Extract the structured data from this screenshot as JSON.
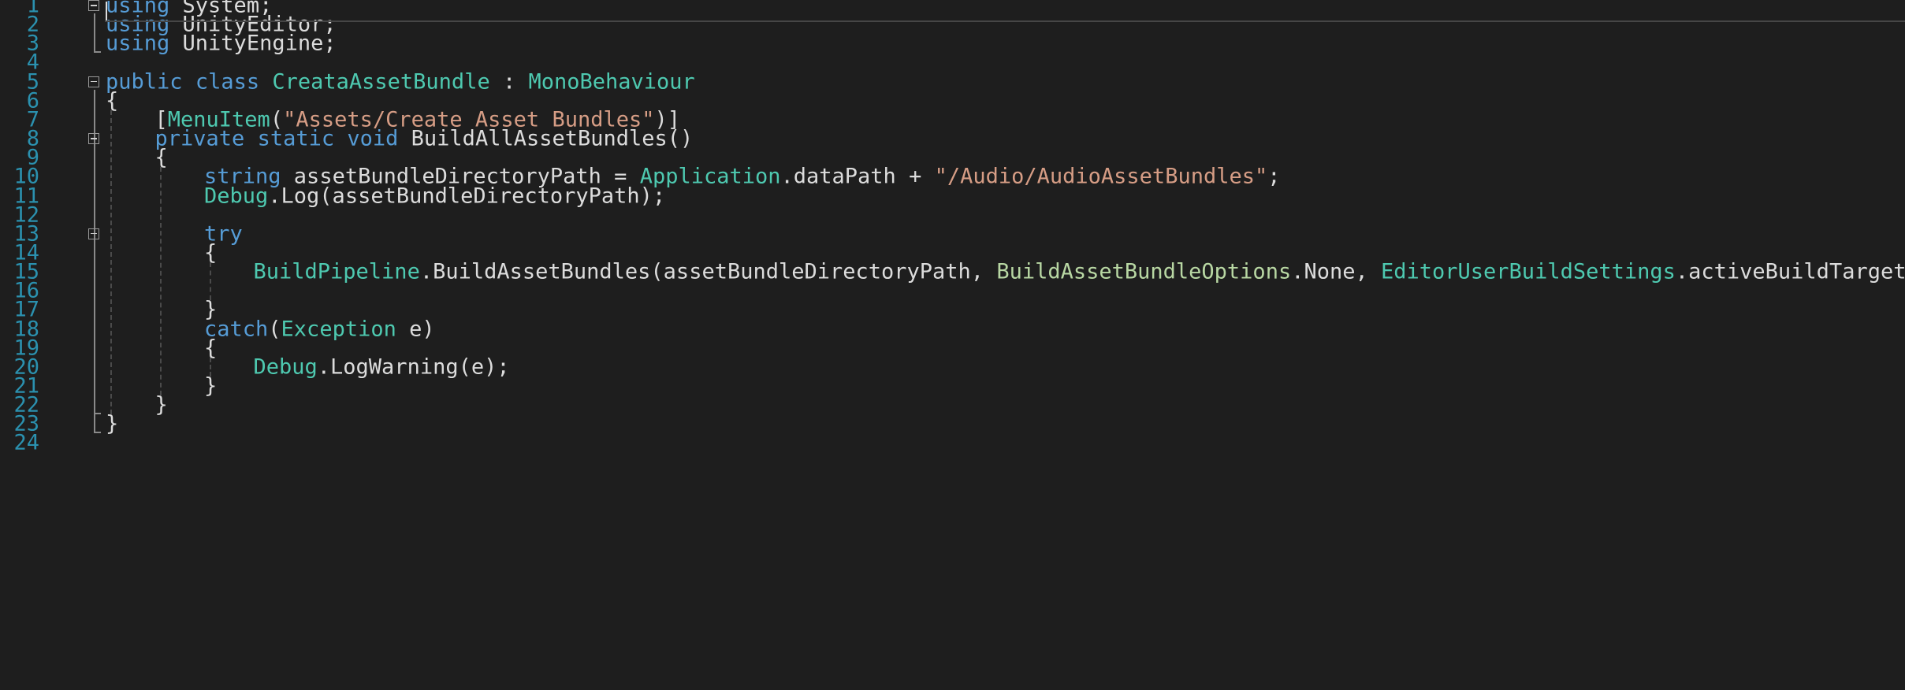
{
  "lines": [
    {
      "n": "1",
      "indent": 0,
      "tokens": [
        {
          "t": "using",
          "c": "kw"
        },
        {
          "t": " System;",
          "c": "pl"
        }
      ]
    },
    {
      "n": "2",
      "indent": 0,
      "tokens": [
        {
          "t": "using",
          "c": "kw"
        },
        {
          "t": " UnityEditor;",
          "c": "pl"
        }
      ]
    },
    {
      "n": "3",
      "indent": 0,
      "tokens": [
        {
          "t": "using",
          "c": "kw"
        },
        {
          "t": " UnityEngine;",
          "c": "pl"
        }
      ]
    },
    {
      "n": "4",
      "indent": 0,
      "tokens": []
    },
    {
      "n": "5",
      "indent": 0,
      "tokens": [
        {
          "t": "public",
          "c": "kw"
        },
        {
          "t": " ",
          "c": "pl"
        },
        {
          "t": "class",
          "c": "kw"
        },
        {
          "t": " ",
          "c": "pl"
        },
        {
          "t": "CreataAssetBundle",
          "c": "ty"
        },
        {
          "t": " : ",
          "c": "pl"
        },
        {
          "t": "MonoBehaviour",
          "c": "ty"
        }
      ]
    },
    {
      "n": "6",
      "indent": 0,
      "tokens": [
        {
          "t": "{",
          "c": "pl"
        }
      ]
    },
    {
      "n": "7",
      "indent": 1,
      "tokens": [
        {
          "t": "[",
          "c": "pl"
        },
        {
          "t": "MenuItem",
          "c": "ty"
        },
        {
          "t": "(",
          "c": "pl"
        },
        {
          "t": "\"Assets/Create Asset Bundles\"",
          "c": "str"
        },
        {
          "t": ")]",
          "c": "pl"
        }
      ]
    },
    {
      "n": "8",
      "indent": 1,
      "tokens": [
        {
          "t": "private",
          "c": "kw"
        },
        {
          "t": " ",
          "c": "pl"
        },
        {
          "t": "static",
          "c": "kw"
        },
        {
          "t": " ",
          "c": "pl"
        },
        {
          "t": "void",
          "c": "kw"
        },
        {
          "t": " BuildAllAssetBundles()",
          "c": "pl"
        }
      ]
    },
    {
      "n": "9",
      "indent": 1,
      "tokens": [
        {
          "t": "{",
          "c": "pl"
        }
      ]
    },
    {
      "n": "10",
      "indent": 2,
      "tokens": [
        {
          "t": "string",
          "c": "kw"
        },
        {
          "t": " assetBundleDirectoryPath = ",
          "c": "pl"
        },
        {
          "t": "Application",
          "c": "ty"
        },
        {
          "t": ".dataPath + ",
          "c": "pl"
        },
        {
          "t": "\"/Audio/AudioAssetBundles\"",
          "c": "str"
        },
        {
          "t": ";",
          "c": "pl"
        }
      ]
    },
    {
      "n": "11",
      "indent": 2,
      "tokens": [
        {
          "t": "Debug",
          "c": "ty"
        },
        {
          "t": ".Log(assetBundleDirectoryPath);",
          "c": "pl"
        }
      ]
    },
    {
      "n": "12",
      "indent": 2,
      "tokens": []
    },
    {
      "n": "13",
      "indent": 2,
      "tokens": [
        {
          "t": "try",
          "c": "kw"
        }
      ]
    },
    {
      "n": "14",
      "indent": 2,
      "tokens": [
        {
          "t": "{",
          "c": "pl"
        }
      ]
    },
    {
      "n": "15",
      "indent": 3,
      "tokens": [
        {
          "t": "BuildPipeline",
          "c": "ty"
        },
        {
          "t": ".BuildAssetBundles(assetBundleDirectoryPath, ",
          "c": "pl"
        },
        {
          "t": "BuildAssetBundleOptions",
          "c": "ty2"
        },
        {
          "t": ".None, ",
          "c": "pl"
        },
        {
          "t": "EditorUserBuildSettings",
          "c": "ty"
        },
        {
          "t": ".activeBuildTarget);",
          "c": "pl"
        }
      ]
    },
    {
      "n": "16",
      "indent": 3,
      "tokens": []
    },
    {
      "n": "17",
      "indent": 2,
      "tokens": [
        {
          "t": "}",
          "c": "pl"
        }
      ]
    },
    {
      "n": "18",
      "indent": 2,
      "tokens": [
        {
          "t": "catch",
          "c": "kw"
        },
        {
          "t": "(",
          "c": "pl"
        },
        {
          "t": "Exception",
          "c": "ty"
        },
        {
          "t": " e)",
          "c": "pl"
        }
      ]
    },
    {
      "n": "19",
      "indent": 2,
      "tokens": [
        {
          "t": "{",
          "c": "pl"
        }
      ]
    },
    {
      "n": "20",
      "indent": 3,
      "tokens": [
        {
          "t": "Debug",
          "c": "ty"
        },
        {
          "t": ".LogWarning(e);",
          "c": "pl"
        }
      ]
    },
    {
      "n": "21",
      "indent": 2,
      "tokens": [
        {
          "t": "}",
          "c": "pl"
        }
      ]
    },
    {
      "n": "22",
      "indent": 1,
      "tokens": [
        {
          "t": "}",
          "c": "pl"
        }
      ]
    },
    {
      "n": "23",
      "indent": 0,
      "tokens": [
        {
          "t": "}",
          "c": "pl"
        }
      ]
    },
    {
      "n": "24",
      "indent": 0,
      "tokens": []
    }
  ],
  "colors": {
    "background": "#1e1e1e",
    "line_number": "#2b91af",
    "keyword": "#569cd6",
    "type": "#4ec9b0",
    "enum_type": "#b8d7a3",
    "string": "#d69d85",
    "plain": "#dcdcdc"
  },
  "icons": {
    "fold_toggle": "collapse-minus-icon"
  }
}
